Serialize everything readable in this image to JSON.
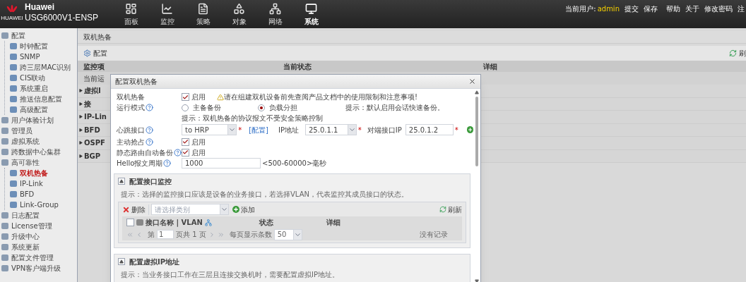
{
  "header": {
    "brand": "Huawei",
    "logo_caption": "HUAWEI",
    "device": "USG6000V1-ENSP",
    "nav": [
      {
        "label": "面板",
        "kind": "dashboard",
        "selected": false
      },
      {
        "label": "监控",
        "kind": "monitor",
        "selected": false
      },
      {
        "label": "策略",
        "kind": "policy",
        "selected": false
      },
      {
        "label": "对象",
        "kind": "object",
        "selected": false
      },
      {
        "label": "网络",
        "kind": "network",
        "selected": false
      },
      {
        "label": "系统",
        "kind": "system",
        "selected": true
      }
    ],
    "user_label": "当前用户:",
    "user": "admin",
    "links": [
      "提交",
      "保存",
      "帮助",
      "关于",
      "修改密码",
      "注"
    ]
  },
  "sidebar": {
    "items": [
      {
        "label": "配置",
        "expanded": true,
        "selected": false,
        "children": [
          {
            "label": "时钟配置",
            "selected": false
          },
          {
            "label": "SNMP",
            "selected": false
          },
          {
            "label": "跨三层MAC识别",
            "selected": false
          },
          {
            "label": "CIS联动",
            "selected": false
          },
          {
            "label": "系统重启",
            "selected": false
          },
          {
            "label": "推送信息配置",
            "selected": false
          },
          {
            "label": "高级配置",
            "selected": false
          }
        ]
      },
      {
        "label": "用户体验计划",
        "selected": false
      },
      {
        "label": "管理员",
        "selected": false
      },
      {
        "label": "虚拟系统",
        "selected": false
      },
      {
        "label": "跨数据中心集群",
        "selected": false
      },
      {
        "label": "高可靠性",
        "expanded": true,
        "selected": false,
        "children": [
          {
            "label": "双机热备",
            "selected": true
          },
          {
            "label": "IP-Link",
            "selected": false
          },
          {
            "label": "BFD",
            "selected": false
          },
          {
            "label": "Link-Group",
            "selected": false
          }
        ]
      },
      {
        "label": "日志配置",
        "selected": false
      },
      {
        "label": "License管理",
        "selected": false
      },
      {
        "label": "升级中心",
        "selected": false
      },
      {
        "label": "系统更新",
        "selected": false
      },
      {
        "label": "配置文件管理",
        "selected": false
      },
      {
        "label": "VPN客户端升级",
        "selected": false
      }
    ]
  },
  "page": {
    "title": "双机热备",
    "config_button": "配置",
    "refresh_button": "刷",
    "columns": [
      "监控项",
      "当前状态",
      "详细"
    ],
    "first_row": "当前运",
    "groups": [
      "虚拟I",
      "接",
      "IP-Lin",
      "BFD",
      "OSPF",
      "BGP"
    ]
  },
  "dialog": {
    "title": "配置双机热备",
    "hrp": {
      "label": "双机热备",
      "checked": true,
      "option": "启用",
      "warning": "请在组建双机设备前先查阅产品文档中的使用限制和注意事项!"
    },
    "mode": {
      "label": "运行模式",
      "options": [
        {
          "label": "主备备份",
          "selected": false
        },
        {
          "label": "负载分担",
          "selected": true
        }
      ],
      "hint": "提示：默认启用会话快速备份。"
    },
    "note": "提示：双机热备的协议报文不受安全策略控制",
    "heartbeat": {
      "label": "心跳接口",
      "value": "to HRP",
      "required": "*",
      "link": "[配置]",
      "ip_label": "IP地址",
      "ip": "25.0.1.1",
      "ip_required": "*",
      "peer_label": "对端接口IP",
      "peer": "25.0.1.2",
      "peer_required": "*"
    },
    "preempt": {
      "label": "主动抢占",
      "checked": true,
      "option": "启用"
    },
    "static_route": {
      "label": "静态路由自动备份",
      "checked": true,
      "option": "启用"
    },
    "hello": {
      "label": "Hello报文周期",
      "value": "1000",
      "range": "<500-60000>毫秒"
    },
    "monitor_section": {
      "title": "配置接口监控",
      "expanded": true,
      "hint": "提示：选择的监控接口应该是设备的业务接口，若选择VLAN，代表监控其成员接口的状态。",
      "delete": "删除",
      "category_placeholder": "请选择类别",
      "add": "添加",
      "refresh": "刷新",
      "columns": [
        "接口名称 | VLAN",
        "状态",
        "详细"
      ],
      "select_all": {
        "checked": false
      },
      "pager": {
        "page_prefix": "第",
        "page": "1",
        "page_suffix": "页共 1 页",
        "per_page_label": "每页显示条数",
        "per_page": "50",
        "empty": "没有记录"
      }
    },
    "vip_section": {
      "title": "配置虚拟IP地址",
      "expanded": true,
      "hint": "提示：当业务接口工作在三层且连接交换机时，需要配置虚拟IP地址。"
    }
  }
}
